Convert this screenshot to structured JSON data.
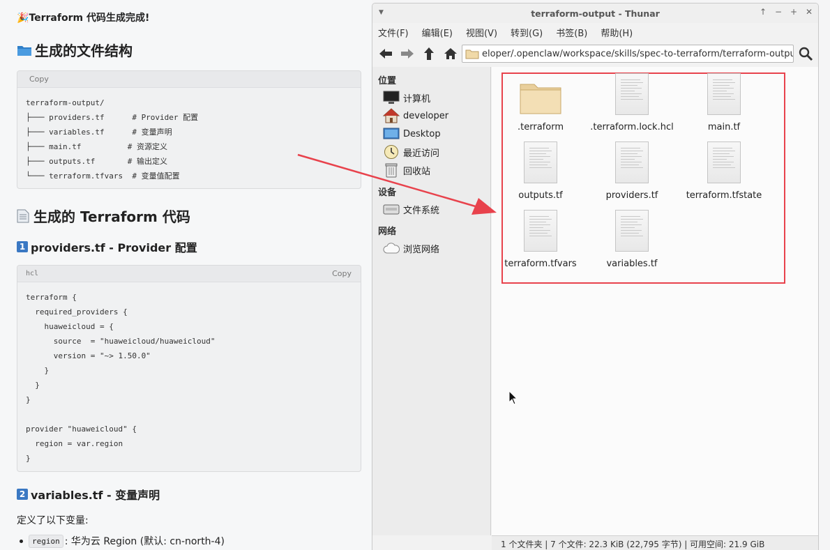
{
  "chat": {
    "done_title": "Terraform 代码生成完成!",
    "structure_heading": "生成的文件结构",
    "structure_copy": "Copy",
    "structure_code": "terraform-output/\n├─── providers.tf      # Provider 配置\n├─── variables.tf      # 变量声明\n├─── main.tf          # 资源定义\n├─── outputs.tf       # 输出定义\n└─── terraform.tfvars  # 变量值配置",
    "code_heading": "生成的 Terraform 代码",
    "sec1_num": "1",
    "sec1_title": "providers.tf - Provider 配置",
    "code1_lang": "hcl",
    "code1_copy": "Copy",
    "code1": "terraform {\n  required_providers {\n    huaweicloud = {\n      source  = \"huaweicloud/huaweicloud\"\n      version = \"~> 1.50.0\"\n    }\n  }\n}\n\nprovider \"huaweicloud\" {\n  region = var.region\n}",
    "sec2_num": "2",
    "sec2_title": "variables.tf - 变量声明",
    "defined_text": "定义了以下变量:",
    "bullet_code": "region",
    "bullet_text": ": 华为云 Region (默认: cn-north-4)"
  },
  "thunar": {
    "title": "terraform-output - Thunar",
    "menu": [
      "文件(F)",
      "编辑(E)",
      "视图(V)",
      "转到(G)",
      "书签(B)",
      "帮助(H)"
    ],
    "location": "eloper/.openclaw/workspace/skills/spec-to-terraform/terraform-output/",
    "sidebar": {
      "places_label": "位置",
      "places": [
        "计算机",
        "developer",
        "Desktop",
        "最近访问",
        "回收站"
      ],
      "devices_label": "设备",
      "devices": [
        "文件系统"
      ],
      "network_label": "网络",
      "network": [
        "浏览网络"
      ]
    },
    "files": [
      ".terraform",
      ".terraform.lock.hcl",
      "main.tf",
      "outputs.tf",
      "providers.tf",
      "terraform.tfstate",
      "terraform.tfvars",
      "variables.tf"
    ],
    "status": "1 个文件夹 | 7 个文件: 22.3 KiB (22,795 字节) | 可用空间: 21.9 GiB"
  },
  "colors": {
    "annotation": "#e8424c",
    "folder": "#f0d9a8",
    "badge": "#3a78c3"
  }
}
